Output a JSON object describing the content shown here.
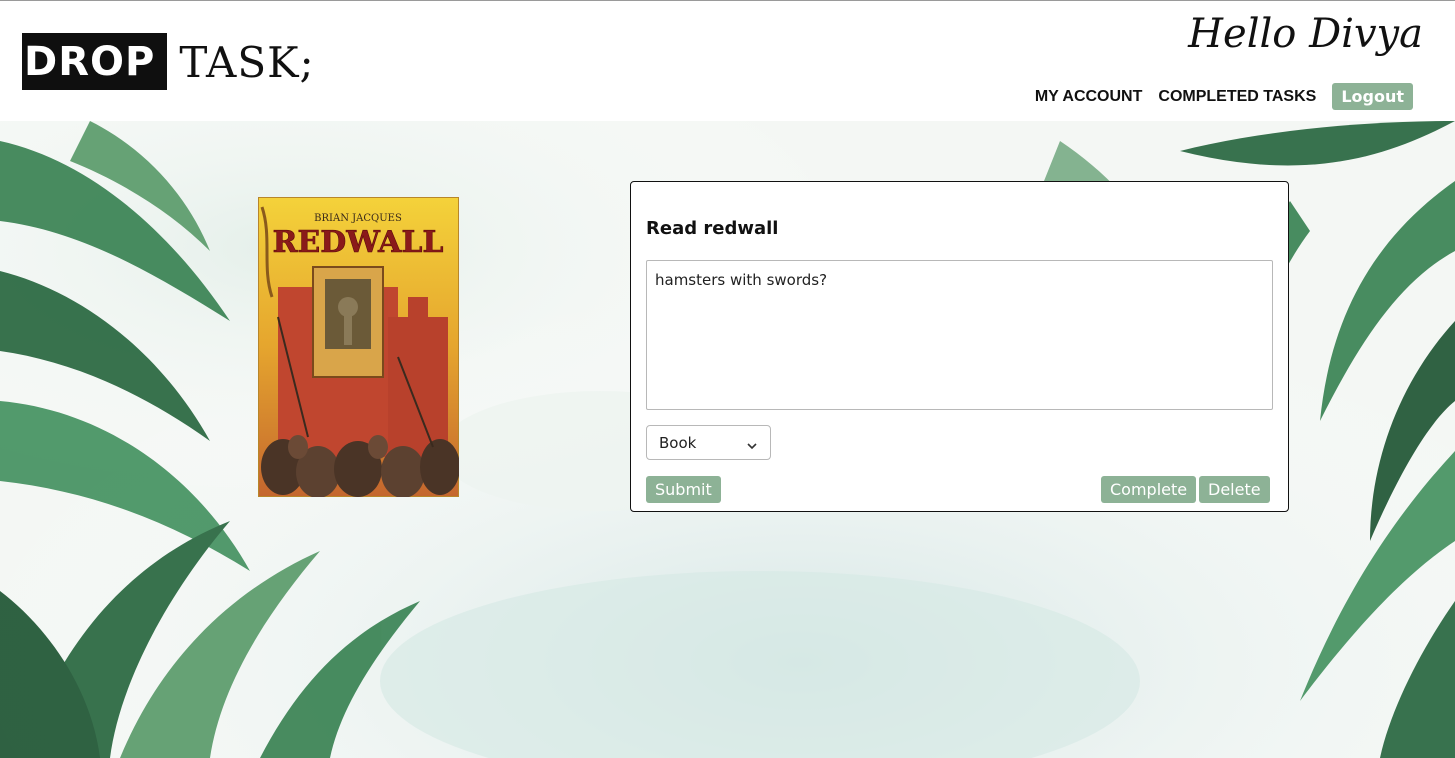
{
  "header": {
    "logo_drop": "DROP",
    "logo_task": "TASK;",
    "greeting": "Hello Divya",
    "nav": {
      "my_account": "MY ACCOUNT",
      "completed_tasks": "COMPLETED TASKS",
      "logout": "Logout"
    }
  },
  "book_cover": {
    "author": "BRIAN JACQUES",
    "title": "REDWALL"
  },
  "task": {
    "title": "Read redwall",
    "notes": "hamsters with swords?",
    "category": "Book",
    "submit_label": "Submit",
    "complete_label": "Complete",
    "delete_label": "Delete"
  },
  "colors": {
    "accent_green": "#8db296",
    "leaf_dark": "#2e6b45",
    "leaf_light": "#5f9e6f"
  }
}
